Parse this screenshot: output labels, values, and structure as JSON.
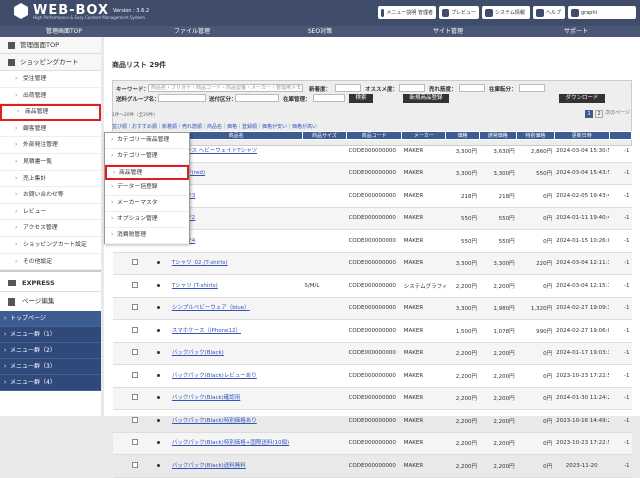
{
  "header": {
    "brand": "WEB-BOX",
    "version": "Version : 3.6.2",
    "tagline": "High Performance & Easy Content Management System",
    "btn_manual": "メニュー説明 管理者",
    "btn_preview": "プレビュー",
    "btn_system": "システム情報",
    "btn_help": "ヘルプ",
    "btn_user": "graphi"
  },
  "nav": [
    "管理画面TOP",
    "ファイル管理",
    "SEO対策",
    "サイト管理",
    "サポート"
  ],
  "sidebar": {
    "top": "管理画面TOP",
    "cart": "ショッピングカート",
    "items": [
      "受注管理",
      "出荷管理",
      "商品管理",
      "顧客管理",
      "外部発注管理",
      "見積書一覧",
      "売上集計",
      "お問い合わせ等",
      "レビュー",
      "アクセス管理",
      "ショッピングカート設定",
      "その他設定"
    ],
    "express": "EXPRESS",
    "page_edit": "ページ編集",
    "dark": [
      "トップページ",
      "メニュー群（1）",
      "メニュー群（2）",
      "メニュー群（3）",
      "メニュー群（4）"
    ]
  },
  "popup": [
    "カテゴリー商品管理",
    "カテゴリー管理",
    "商品管理",
    "データー括登録",
    "メーカーマスタ",
    "オプション管理",
    "消費税管理"
  ],
  "main": {
    "title": "商品リスト 29件",
    "kw_label": "キーワード：",
    "kw_placeholder": "商品名・フリガナ・商品コード・商品型番・メーカー・管理用メモ",
    "new_label": "新着度：",
    "rec_label": "オススメ度：",
    "sales_label": "売れ筋度：",
    "stock_label": "在庫転分：",
    "group_label": "送料グループ名：",
    "sort_label": "送付区分：",
    "stock2_label": "在庫管理：",
    "search_btn": "検索",
    "new_btn": "新規商品登録",
    "download_btn": "ダウンロード",
    "count": "1件～20件（全29件）",
    "pages": [
      "1",
      "2"
    ],
    "page_label": "次のページ",
    "links": "並び順｜おすすめ順｜新着順｜売れ筋順｜商品名｜価格｜登録順｜価格が安い｜価格が高い"
  },
  "table": {
    "headers": [
      "",
      "",
      "",
      "商品名",
      "商品サイズ",
      "商品コード",
      "メーカー",
      "価格",
      "通常価格",
      "特別価格",
      "更新日時",
      ""
    ],
    "rows": [
      [
        "5.6オンス ヘビーウェイトTシャツ",
        "",
        "CODE000000000",
        "MAKER",
        "3,300円",
        "3,630円",
        "2,860円",
        "2024-03-04 15:30:50",
        "-1"
      ],
      [
        "Tシャツ(red)",
        "",
        "CODE000000000",
        "MAKER",
        "3,300円",
        "3,300円",
        "550円",
        "2024-03-04 15:43:57",
        "-1"
      ],
      [
        "Tシャツ3",
        "",
        "CODE000000000",
        "MAKER",
        "218円",
        "218円",
        "0円",
        "2024-02-05 19:43:40",
        "-1"
      ],
      [
        "Tシャツ2",
        "",
        "CODE000000000",
        "MAKER",
        "550円",
        "550円",
        "0円",
        "2024-01-11 19:40:40",
        "-1"
      ],
      [
        "Tシャツ4",
        "",
        "CODE000000000",
        "MAKER",
        "550円",
        "550円",
        "0円",
        "2024-01-15 10:26:05",
        "-1"
      ],
      [
        "Tシャツ_02 (T-shirts)",
        "",
        "CODE000000000",
        "MAKER",
        "3,300円",
        "3,300円",
        "220円",
        "2024-03-04 12:11:34",
        "-1"
      ],
      [
        "Tシャツ (T-shirts)",
        "S/M/L",
        "CODE000000000",
        "システムグラフィ",
        "2,200円",
        "2,200円",
        "0円",
        "2024-03-04 12:15:18",
        "-1"
      ],
      [
        "シンプルベビーウェア（blue）",
        "",
        "CODE000000000",
        "MAKER",
        "3,300円",
        "1,980円",
        "1,320円",
        "2024-02-27 19:09:35",
        "-1"
      ],
      [
        "スマホケース（iPhone12）",
        "",
        "CODE000000000",
        "MAKER",
        "1,500円",
        "1,078円",
        "990円",
        "2024-02-27 19:06:01",
        "-1"
      ],
      [
        "バックパック(Black)",
        "",
        "CODE000000000",
        "MAKER",
        "2,200円",
        "2,200円",
        "0円",
        "2024-01-17 19:03:31",
        "-1"
      ],
      [
        "バックパック(Black)レビューあり",
        "",
        "CODE000000000",
        "MAKER",
        "2,200円",
        "2,200円",
        "0円",
        "2023-10-23 17:22:55",
        "-1"
      ],
      [
        "バックパック(Black)確認用",
        "",
        "CODE000000000",
        "MAKER",
        "2,200円",
        "2,200円",
        "0円",
        "2024-01-30 11:24:27",
        "-1"
      ],
      [
        "バックパック(Black)特別価格あり",
        "",
        "CODE000000000",
        "MAKER",
        "2,200円",
        "2,200円",
        "0円",
        "2023-10-16 14:49:22",
        "-1"
      ],
      [
        "バックパック(Black)特別価格+国際送料(10個)",
        "",
        "CODE000000000",
        "MAKER",
        "2,200円",
        "2,200円",
        "0円",
        "2023-10-23 17:22:55",
        "-1"
      ],
      [
        "バックパック(Black)送料無料",
        "",
        "CODE000000000",
        "MAKER",
        "2,200円",
        "2,200円",
        "0円",
        "2023-11-20",
        "-1"
      ]
    ]
  },
  "colors": {
    "header": "#3f4d6a",
    "accent": "#3d5c91",
    "highlight": "#e02020"
  }
}
